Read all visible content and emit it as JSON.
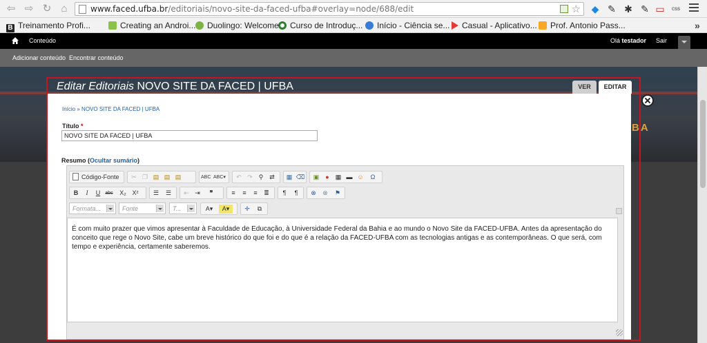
{
  "browser": {
    "url_host": "www.faced.ufba.br",
    "url_path": "/editoriais/novo-site-da-faced-ufba#overlay=node/688/edit"
  },
  "bookmarks": [
    {
      "label": "Treinamento Profi...",
      "icon": "b-icon",
      "color": "#222222"
    },
    {
      "label": "Creating an Androi...",
      "icon": "android-icon",
      "color": "#8bc34a"
    },
    {
      "label": "Duolingo: Welcome",
      "icon": "duolingo-icon",
      "color": "#7cb342"
    },
    {
      "label": "Curso de Introduç...",
      "icon": "circle-icon",
      "color": "#2e7d32"
    },
    {
      "label": "Início - Ciência se...",
      "icon": "globe-icon",
      "color": "#3a7bd5"
    },
    {
      "label": "Casual - Aplicativo...",
      "icon": "play-icon",
      "color": "#e53935"
    },
    {
      "label": "Prof. Antonio Pass...",
      "icon": "crown-icon",
      "color": "#f9a825"
    }
  ],
  "admin": {
    "content": "Conteúdo",
    "greeting": "Olá",
    "username": "testador",
    "logout": "Sair",
    "shortcuts": [
      "Adicionar conteúdo",
      "Encontrar conteúdo"
    ]
  },
  "overlay": {
    "title_prefix": "Editar Editoriais",
    "title_node": "NOVO SITE DA FACED | UFBA",
    "tabs": [
      "VER",
      "EDITAR"
    ],
    "breadcrumb": [
      "Início",
      "»",
      "NOVO SITE DA FACED | UFBA"
    ]
  },
  "form": {
    "title_label": "Título",
    "required": "*",
    "title_value": "NOVO SITE DA FACED | UFBA",
    "body_label": "Resumo",
    "summary_toggle": "Ocultar sumário"
  },
  "editor": {
    "source_button": "Código-Fonte",
    "format_placeholder": "Formata...",
    "font_placeholder": "Fonte",
    "size_placeholder": "T...",
    "content": "É com muito prazer que vimos apresentar à Faculdade de Educação, à Universidade Federal da Bahia e ao mundo o Novo Site da FACED-UFBA. Antes da apresentação do conceito que rege o Novo Site, cabe um breve histórico do que foi e do que é a relação da FACED-UFBA com as tecnologias antigas e as contemporâneas. O que será, com tempo e experiência, certamente saberemos.",
    "buttons_row2": [
      "B",
      "I",
      "U",
      "abc",
      "X₂",
      "X²"
    ]
  },
  "site": {
    "logo_fragment": "BA"
  }
}
